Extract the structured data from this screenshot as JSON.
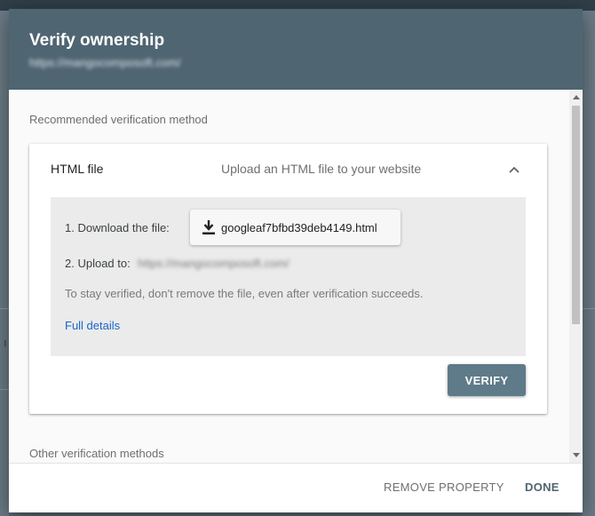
{
  "dialog": {
    "title": "Verify ownership",
    "subtitle": "https://mangocomposoft.com/"
  },
  "sections": {
    "recommended_label": "Recommended verification method",
    "other_label": "Other verification methods"
  },
  "method": {
    "title": "HTML file",
    "description": "Upload an HTML file to your website",
    "step1_label": "1. Download the file:",
    "download_filename": "googleaf7bfbd39deb4149.html",
    "step2_label": "2. Upload to:",
    "upload_url": "https://mangocomposoft.com/",
    "note": "To stay verified, don't remove the file, even after verification succeeds.",
    "details_link": "Full details",
    "verify_label": "VERIFY"
  },
  "footer": {
    "remove_label": "REMOVE PROPERTY",
    "done_label": "DONE"
  },
  "colors": {
    "header_bg": "#4f6572",
    "verify_bg": "#5f7a88",
    "link": "#1a66c8"
  }
}
